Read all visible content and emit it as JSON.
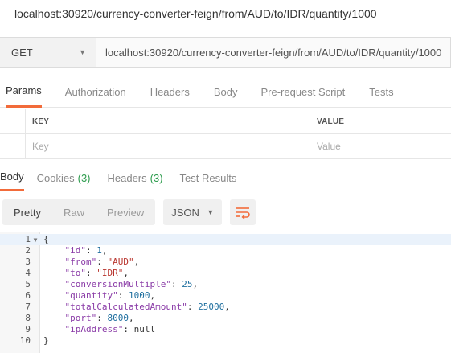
{
  "title": "localhost:30920/currency-converter-feign/from/AUD/to/IDR/quantity/1000",
  "request": {
    "method": "GET",
    "url": "localhost:30920/currency-converter-feign/from/AUD/to/IDR/quantity/1000"
  },
  "request_tabs": [
    "Params",
    "Authorization",
    "Headers",
    "Body",
    "Pre-request Script",
    "Tests"
  ],
  "params": {
    "key_header": "KEY",
    "value_header": "VALUE",
    "key_placeholder": "Key",
    "value_placeholder": "Value"
  },
  "response_tabs": [
    {
      "label": "Body",
      "count": ""
    },
    {
      "label": "Cookies",
      "count": "(3)"
    },
    {
      "label": "Headers",
      "count": "(3)"
    },
    {
      "label": "Test Results",
      "count": ""
    }
  ],
  "view_modes": [
    "Pretty",
    "Raw",
    "Preview"
  ],
  "format": "JSON",
  "code_lines": [
    {
      "n": "1",
      "text": "{"
    },
    {
      "n": "2",
      "key": "id",
      "val": "1",
      "type": "num",
      "comma": true
    },
    {
      "n": "3",
      "key": "from",
      "val": "AUD",
      "type": "str",
      "comma": true
    },
    {
      "n": "4",
      "key": "to",
      "val": "IDR",
      "type": "str",
      "comma": true
    },
    {
      "n": "5",
      "key": "conversionMultiple",
      "val": "25",
      "type": "num",
      "comma": true
    },
    {
      "n": "6",
      "key": "quantity",
      "val": "1000",
      "type": "num",
      "comma": true
    },
    {
      "n": "7",
      "key": "totalCalculatedAmount",
      "val": "25000",
      "type": "num",
      "comma": true
    },
    {
      "n": "8",
      "key": "port",
      "val": "8000",
      "type": "num",
      "comma": true
    },
    {
      "n": "9",
      "key": "ipAddress",
      "val": "null",
      "type": "null",
      "comma": false
    },
    {
      "n": "10",
      "text": "}"
    }
  ],
  "colors": {
    "accent": "#f26b3a",
    "count": "#2e9c4e",
    "json_key": "#8a3ba7",
    "json_string": "#b8322b",
    "json_number": "#1f6f9f"
  }
}
